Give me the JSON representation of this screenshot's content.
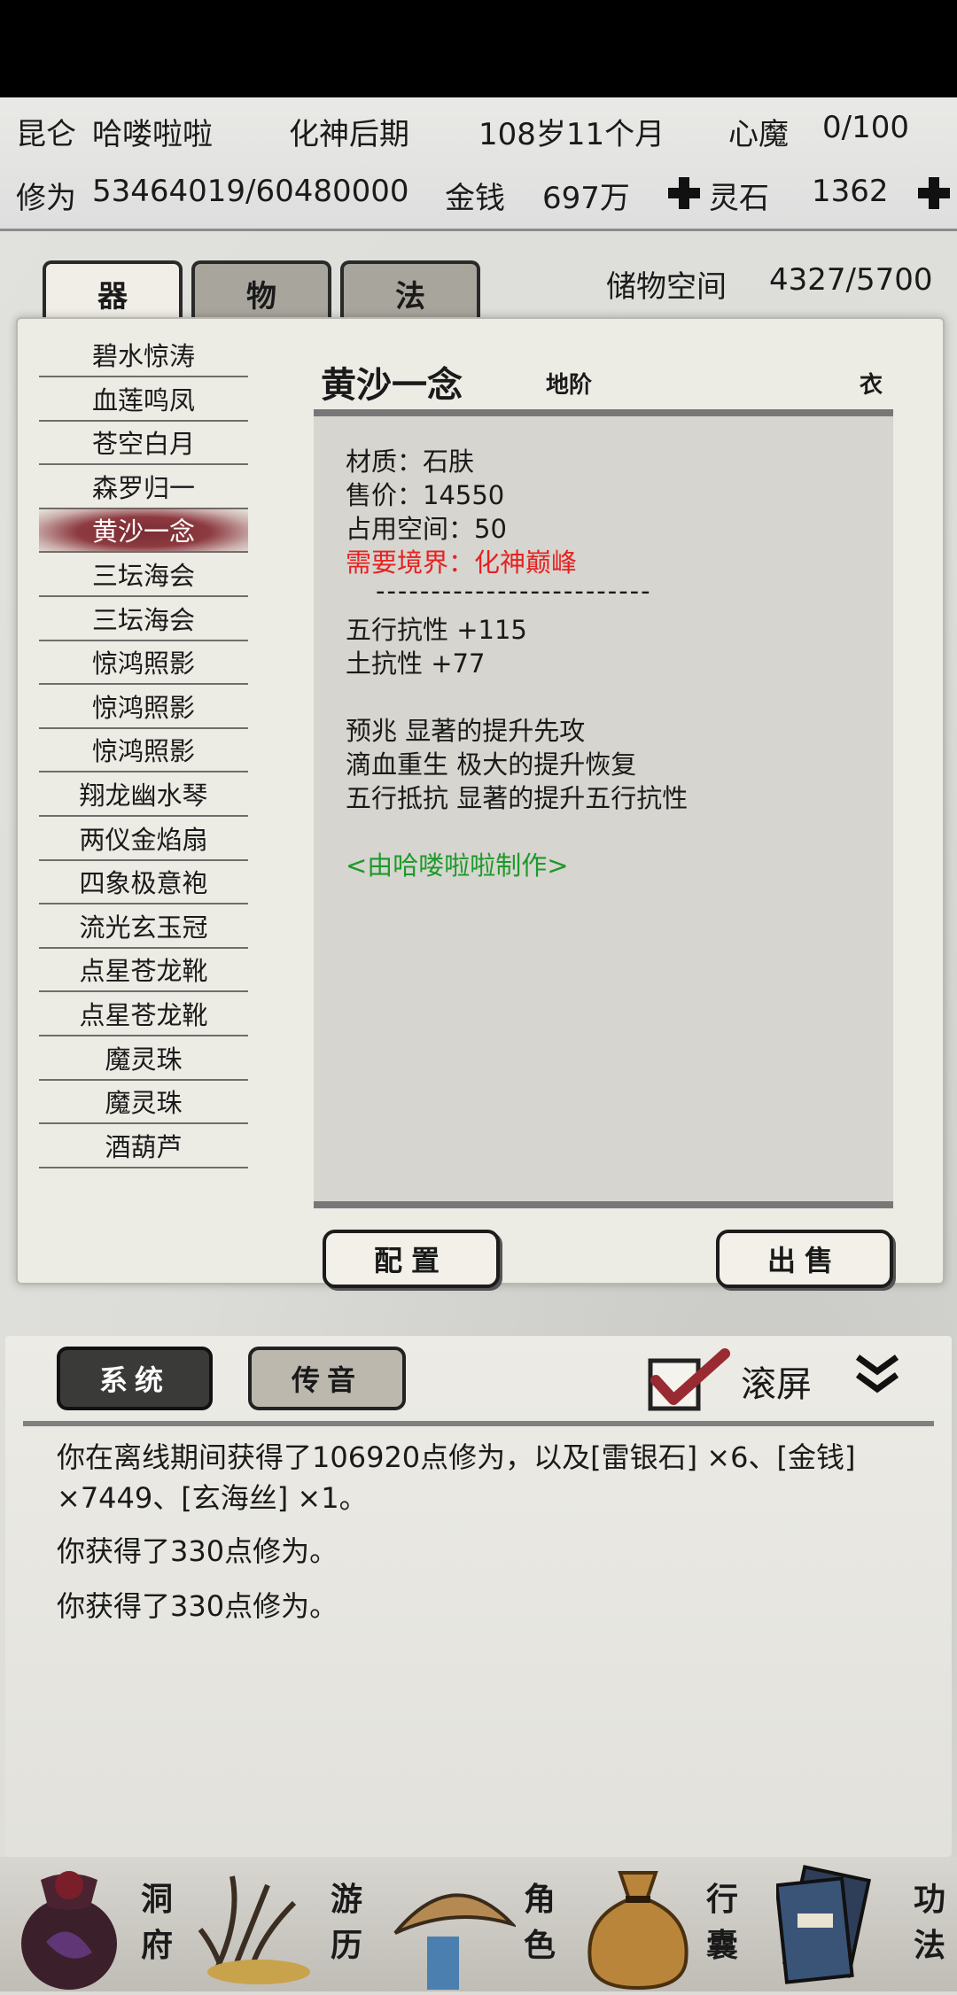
{
  "header": {
    "sect": "昆仑",
    "name": "哈喽啦啦",
    "realm": "化神后期",
    "age": "108岁11个月",
    "demon_label": "心魔",
    "demon_value": "0/100",
    "cultivation_label": "修为",
    "cultivation_value": "53464019/60480000",
    "money_label": "金钱",
    "money_value": "697万",
    "stone_label": "灵石",
    "stone_value": "1362"
  },
  "tabs": [
    "器",
    "物",
    "法"
  ],
  "storage": {
    "label": "储物空间",
    "value": "4327/5700"
  },
  "items": [
    "碧水惊涛",
    "血莲鸣凤",
    "苍空白月",
    "森罗归一",
    "黄沙一念",
    "三坛海会",
    "三坛海会",
    "惊鸿照影",
    "惊鸿照影",
    "惊鸿照影",
    "翔龙幽水琴",
    "两仪金焰扇",
    "四象极意袍",
    "流光玄玉冠",
    "点星苍龙靴",
    "点星苍龙靴",
    "魔灵珠",
    "魔灵珠",
    "酒葫芦"
  ],
  "selected_index": 4,
  "detail": {
    "title": "黄沙一念",
    "grade": "地阶",
    "slot": "衣",
    "material": "材质：石肤",
    "price": "售价：14550",
    "space": "占用空间：50",
    "requirement": "需要境界：化神巅峰",
    "divider": "-------------------------",
    "stat1": "五行抗性 +115",
    "stat2": "土抗性 +77",
    "effect1": "预兆 显著的提升先攻",
    "effect2": "滴血重生 极大的提升恢复",
    "effect3": "五行抵抗 显著的提升五行抗性",
    "crafter": "<由哈喽啦啦制作>"
  },
  "actions": {
    "equip": "配置",
    "sell": "出售"
  },
  "log_tabs": {
    "system": "系统",
    "whisper": "传音"
  },
  "scroll_label": "滚屏",
  "log": [
    "你在离线期间获得了106920点修为，以及[雷银石] ×6、[金钱] ×7449、[玄海丝] ×1。",
    "你获得了330点修为。",
    "你获得了330点修为。"
  ],
  "nav": [
    {
      "label": "洞府",
      "icon": "cave-bag-icon"
    },
    {
      "label": "游历",
      "icon": "grass-icon"
    },
    {
      "label": "角色",
      "icon": "straw-hat-icon"
    },
    {
      "label": "行囊",
      "icon": "pouch-icon"
    },
    {
      "label": "功法",
      "icon": "scroll-book-icon"
    }
  ],
  "colors": {
    "requirement": "#e52222",
    "crafter": "#1c9a2a",
    "selected": "#8a343b"
  }
}
